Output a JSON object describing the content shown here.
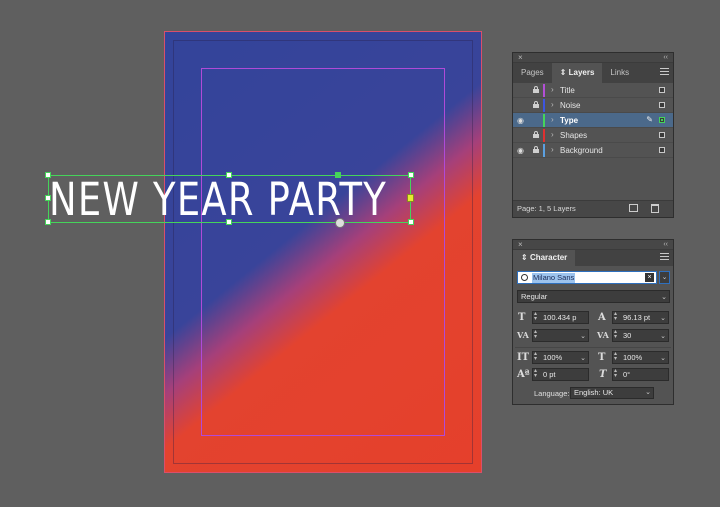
{
  "document": {
    "headline": "NEW YEAR PARTY",
    "gradient_colors": [
      "#33449a",
      "#a5407a",
      "#e3432f"
    ]
  },
  "layers_panel": {
    "tabs": [
      {
        "label": "Pages",
        "active": false
      },
      {
        "label": "Layers",
        "active": true
      },
      {
        "label": "Links",
        "active": false
      }
    ],
    "layers": [
      {
        "name": "Title",
        "color": "#b34fd6",
        "visible": false,
        "locked": true,
        "selected": false
      },
      {
        "name": "Noise",
        "color": "#3d55e0",
        "visible": false,
        "locked": true,
        "selected": false
      },
      {
        "name": "Type",
        "color": "#45d45a",
        "visible": true,
        "locked": false,
        "selected": true
      },
      {
        "name": "Shapes",
        "color": "#e03030",
        "visible": false,
        "locked": true,
        "selected": false
      },
      {
        "name": "Background",
        "color": "#5ba0e0",
        "visible": true,
        "locked": true,
        "selected": false
      }
    ],
    "footer_info": "Page: 1, 5 Layers"
  },
  "character_panel": {
    "title": "Character",
    "font_family": "Milano Sans",
    "font_style": "Regular",
    "font_size": "100.434 p",
    "leading": "96.13 pt",
    "kerning": "",
    "tracking": "30",
    "vertical_scale": "100%",
    "horizontal_scale": "100%",
    "baseline_shift": "0 pt",
    "skew": "0°",
    "language_label": "Language:",
    "language": "English: UK"
  },
  "icons": {
    "close": "×",
    "collapse": "‹‹",
    "eye": "👁",
    "chevron": "›",
    "pen": "✎",
    "dropdown": "⌄"
  }
}
